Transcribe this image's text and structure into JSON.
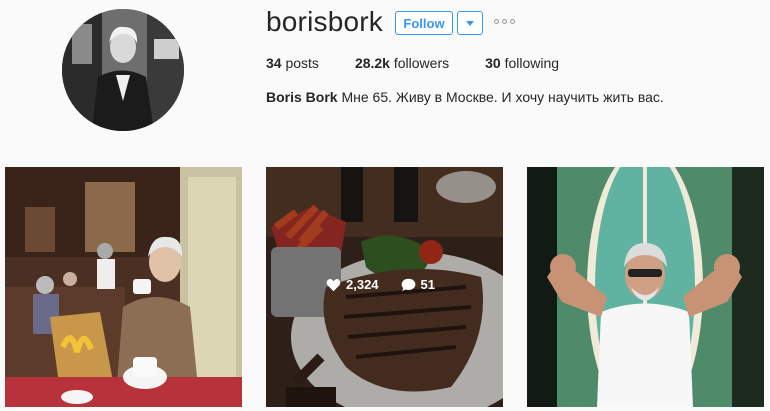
{
  "profile": {
    "username": "borisbork",
    "follow_label": "Follow",
    "stats": {
      "posts_count": "34",
      "posts_label": " posts",
      "followers_count": "28.2k",
      "followers_label": " followers",
      "following_count": "30",
      "following_label": " following"
    },
    "bio_name": "Boris Bork",
    "bio_text": " Мне 65. Живу в Москве. И хочу научить жить вас."
  },
  "posts": [
    {
      "subject": "man-drinking-coffee-in-cafe"
    },
    {
      "subject": "t-bone-steak-with-fries",
      "likes": "2,324",
      "comments": "51"
    },
    {
      "subject": "man-flexing-in-front-of-surfboard"
    }
  ],
  "colors": {
    "accent": "#3897f0",
    "text": "#262626",
    "background": "#fafafa"
  },
  "icons": [
    "chevron-down-icon",
    "more-options-icon",
    "heart-icon",
    "comment-icon"
  ]
}
